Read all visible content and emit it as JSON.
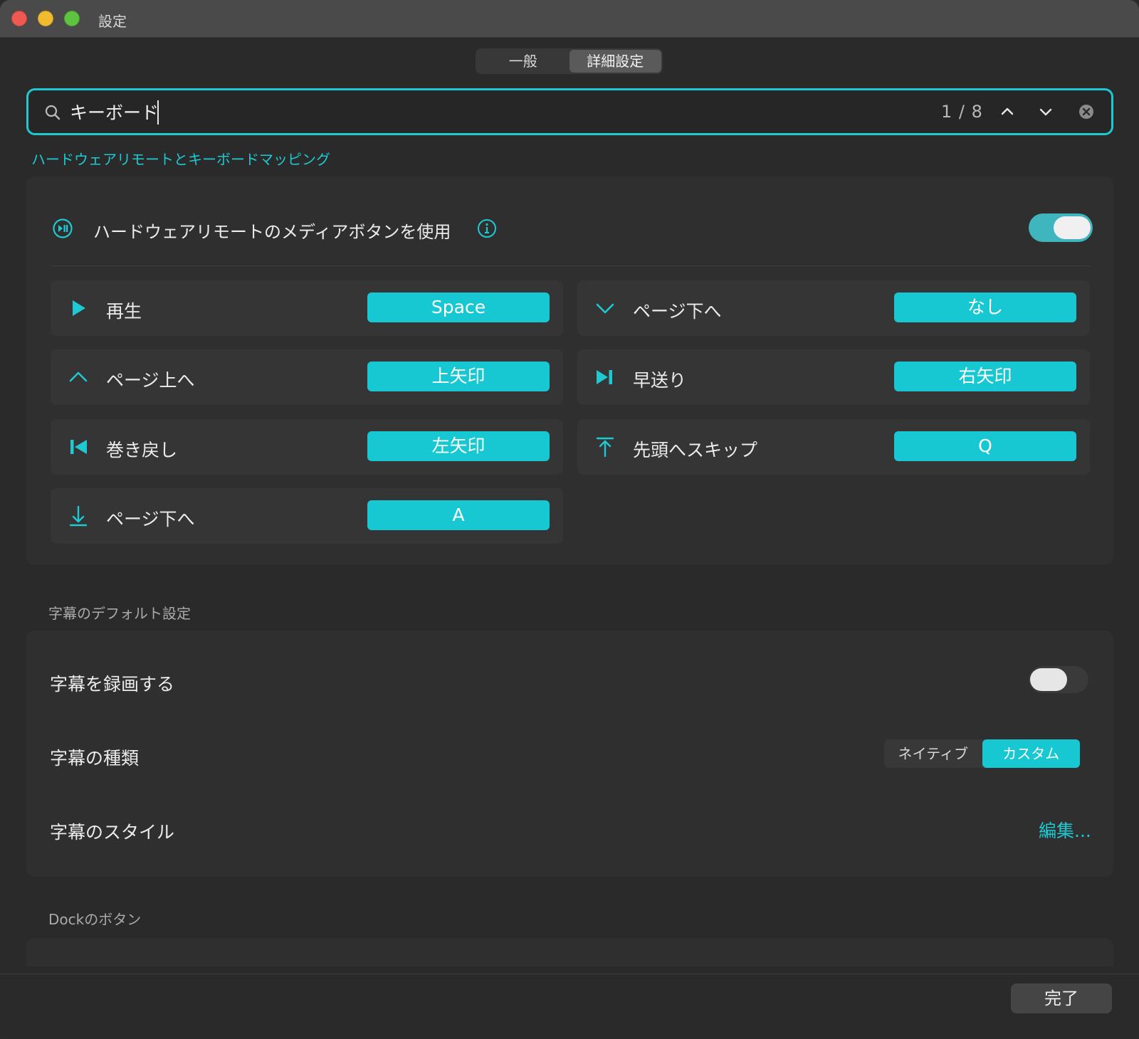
{
  "window": {
    "title": "設定"
  },
  "tabs": [
    {
      "label": "一般",
      "active": false
    },
    {
      "label": "詳細設定",
      "active": true
    }
  ],
  "search": {
    "value": "キーボード",
    "count": "1 / 8"
  },
  "section_link": "ハードウェアリモートとキーボードマッピング",
  "media": {
    "label": "ハードウェアリモートのメディアボタンを使用",
    "enabled": true
  },
  "shortcuts": [
    {
      "icon": "play-icon",
      "label": "再生",
      "key": "Space"
    },
    {
      "icon": "chevron-down-icon",
      "label": "ページ下へ",
      "key": "なし"
    },
    {
      "icon": "chevron-up-icon",
      "label": "ページ上へ",
      "key": "上矢印"
    },
    {
      "icon": "fast-forward-icon",
      "label": "早送り",
      "key": "右矢印"
    },
    {
      "icon": "rewind-icon",
      "label": "巻き戻し",
      "key": "左矢印"
    },
    {
      "icon": "skip-to-top-icon",
      "label": "先頭へスキップ",
      "key": "Q"
    },
    {
      "icon": "arrow-down-icon",
      "label": "ページ下へ",
      "key": "A"
    }
  ],
  "subtitles": {
    "header": "字幕のデフォルト設定",
    "record_label": "字幕を録画する",
    "record_enabled": false,
    "type_label": "字幕の種類",
    "type_options": [
      "ネイティブ",
      "カスタム"
    ],
    "type_selected": "カスタム",
    "style_label": "字幕のスタイル",
    "edit_label": "編集..."
  },
  "dock": {
    "header": "Dockのボタン"
  },
  "footer": {
    "done_label": "完了"
  },
  "colors": {
    "accent": "#1ec9d2",
    "background": "#2a2a2a",
    "panel": "#2f2f2f"
  }
}
